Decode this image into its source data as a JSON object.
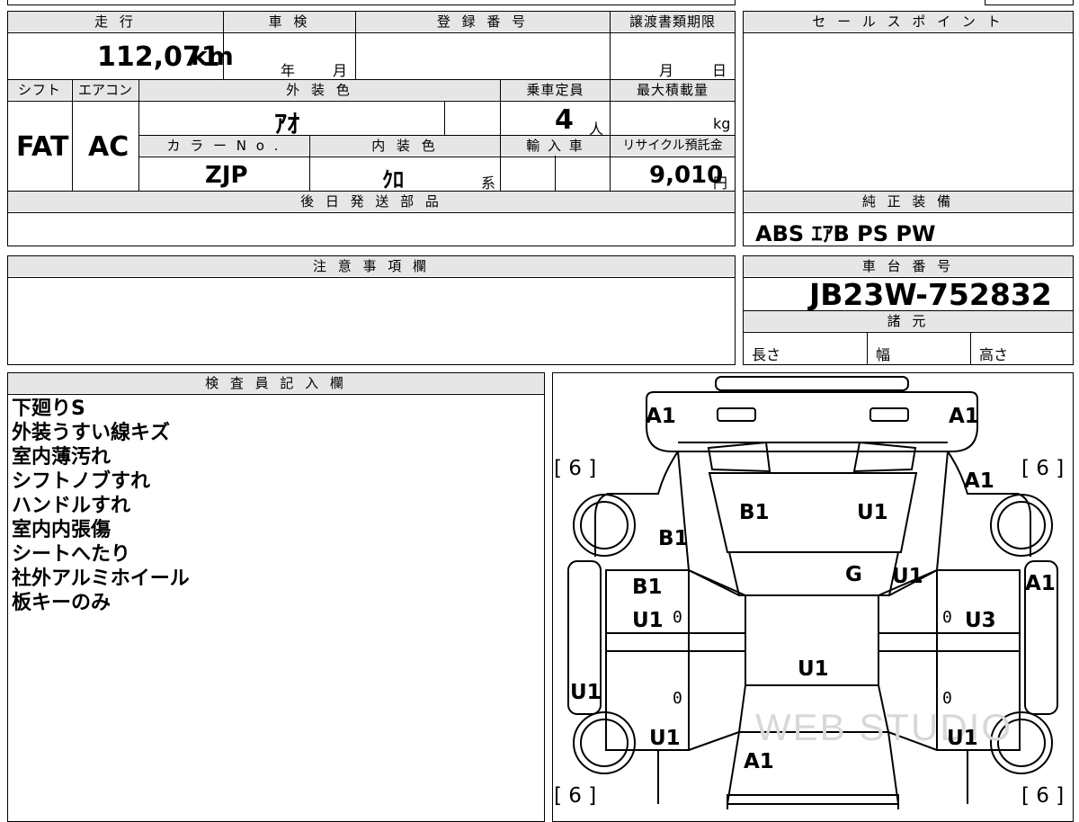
{
  "labels": {
    "mileage": "走 行",
    "inspection": "車 検",
    "registration": "登 録 番 号",
    "transfer_deadline": "譲渡書類期限",
    "sales_point": "セ ー ル ス ポ イ ン ト",
    "shift": "シフト",
    "aircon": "エアコン",
    "exterior_color": "外 装 色",
    "capacity": "乗車定員",
    "max_load": "最大積載量",
    "color_no": "カ ラ ー N o .",
    "interior_color": "内 装 色",
    "import": "輸 入 車",
    "recycle_fee": "リサイクル預託金",
    "later_parts": "後 日 発 送 部 品",
    "standard_equipment": "純 正 装 備",
    "notes": "注 意 事 項 欄",
    "chassis_no": "車 台 番 号",
    "specs": "諸 元",
    "length": "長さ",
    "width": "幅",
    "height": "高さ",
    "inspector": "検 査 員 記 入 欄"
  },
  "values": {
    "mileage": "112,071",
    "mileage_unit": "km",
    "inspection_year": "年",
    "inspection_month": "月",
    "transfer_month": "月",
    "transfer_day": "日",
    "shift": "FAT",
    "aircon": "AC",
    "exterior_color": "ｱｵ",
    "capacity": "4",
    "capacity_unit": "人",
    "max_load_unit": "kg",
    "color_no": "ZJP",
    "interior_color": "ｸﾛ",
    "interior_suffix": "系",
    "recycle_fee": "9,010",
    "recycle_unit": "円",
    "standard_equipment": "ABS  ｴｱB  PS  PW",
    "chassis_no": "JB23W-752832"
  },
  "inspector_notes": [
    "下廻りS",
    "外装うすい線キズ",
    "室内薄汚れ",
    "シフトノブすれ",
    "ハンドルすれ",
    "室内内張傷",
    "シートへたり",
    "社外アルミホイール",
    "板キーのみ"
  ],
  "diagram": {
    "marks": [
      "A1",
      "A1",
      "B1",
      "U1",
      "A1",
      "B1",
      "G",
      "U1",
      "B1",
      "A1",
      "U1",
      "U3",
      "U1",
      "U1",
      "U1",
      "U1",
      "A1"
    ],
    "tires": [
      "[ 6 ]",
      "[ 6 ]",
      "[ 6 ]",
      "[ 6 ]"
    ],
    "zeros": [
      "0",
      "0",
      "0",
      "0"
    ],
    "watermark": "WEB STUDIO"
  }
}
